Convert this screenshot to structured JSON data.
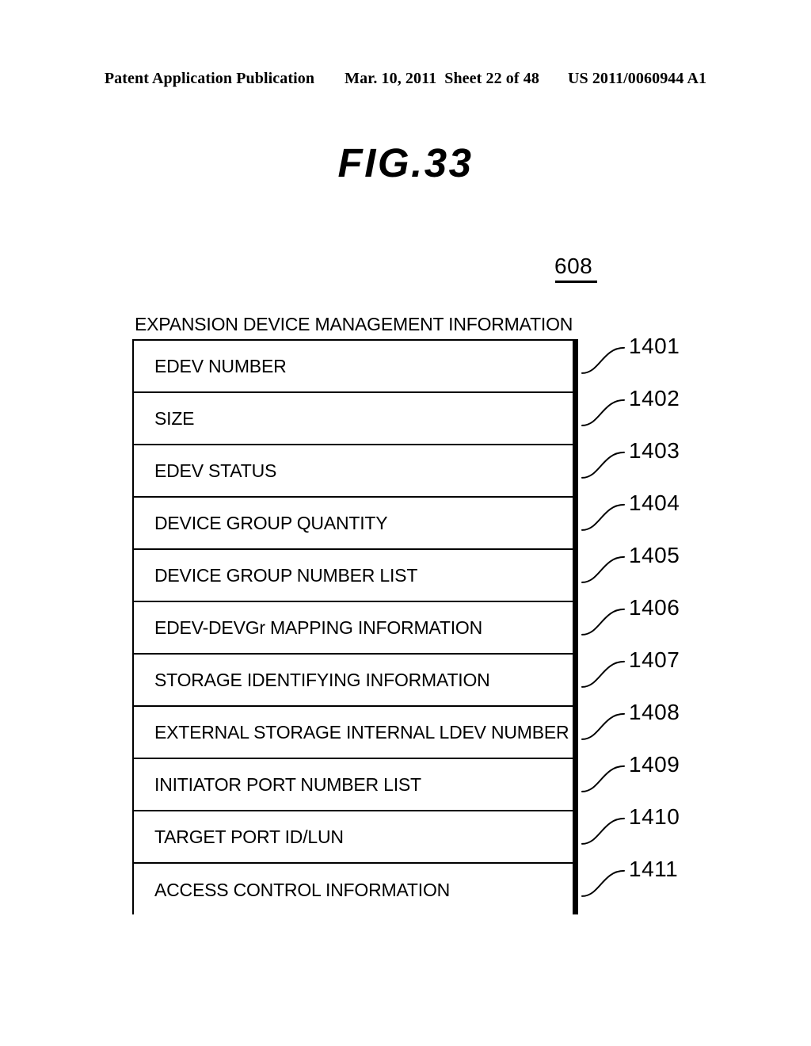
{
  "header": {
    "publication": "Patent Application Publication",
    "date": "Mar. 10, 2011",
    "sheet": "Sheet 22 of 48",
    "patent_number": "US 2011/0060944 A1"
  },
  "figure": {
    "title": "FIG.33",
    "reference_number": "608",
    "caption": "EXPANSION DEVICE MANAGEMENT INFORMATION"
  },
  "table": {
    "rows": [
      {
        "label": "EDEV NUMBER",
        "ref": "1401"
      },
      {
        "label": "SIZE",
        "ref": "1402"
      },
      {
        "label": "EDEV STATUS",
        "ref": "1403"
      },
      {
        "label": "DEVICE GROUP QUANTITY",
        "ref": "1404"
      },
      {
        "label": "DEVICE GROUP NUMBER LIST",
        "ref": "1405"
      },
      {
        "label": "EDEV-DEVGr MAPPING INFORMATION",
        "ref": "1406"
      },
      {
        "label": "STORAGE IDENTIFYING INFORMATION",
        "ref": "1407"
      },
      {
        "label": "EXTERNAL STORAGE INTERNAL LDEV NUMBER",
        "ref": "1408"
      },
      {
        "label": "INITIATOR PORT NUMBER LIST",
        "ref": "1409"
      },
      {
        "label": "TARGET PORT ID/LUN",
        "ref": "1410"
      },
      {
        "label": "ACCESS CONTROL INFORMATION",
        "ref": "1411"
      }
    ]
  },
  "colors": {
    "ink": "#000000",
    "paper": "#ffffff"
  }
}
